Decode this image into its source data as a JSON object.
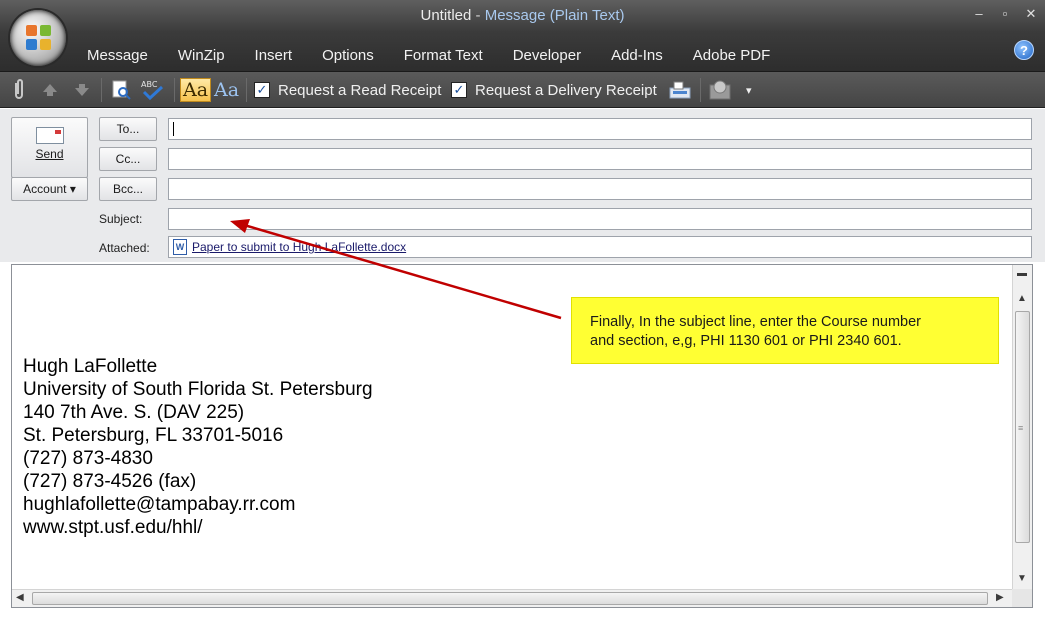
{
  "window": {
    "title_doc": "Untitled",
    "title_sep": " - ",
    "title_app": "Message (Plain Text)",
    "controls": [
      "–",
      "▫",
      "✕"
    ]
  },
  "ribbon": {
    "tabs": [
      "Message",
      "WinZip",
      "Insert",
      "Options",
      "Format Text",
      "Developer",
      "Add-Ins",
      "Adobe PDF"
    ],
    "help": "?"
  },
  "toolbar": {
    "aa_label": "Aa",
    "read_receipt_check": "✓",
    "read_receipt_label": "Request a Read Receipt",
    "delivery_receipt_check": "✓",
    "delivery_receipt_label": "Request a Delivery Receipt",
    "more": "▾"
  },
  "compose": {
    "send_label": "Send",
    "account_label": "Account ▾",
    "to_label": "To...",
    "cc_label": "Cc...",
    "bcc_label": "Bcc...",
    "subject_label": "Subject:",
    "attached_label": "Attached:",
    "to_value": "",
    "cc_value": "",
    "bcc_value": "",
    "subject_value": "",
    "attachment_name": "Paper to submit to Hugh LaFollette.docx",
    "doc_icon": "W"
  },
  "body": {
    "signature": [
      "Hugh LaFollette",
      "University of South Florida St. Petersburg",
      "140 7th Ave. S. (DAV 225)",
      "St. Petersburg, FL 33701-5016",
      "(727) 873-4830",
      "(727) 873-4526 (fax)",
      "hughlafollette@tampabay.rr.com",
      "www.stpt.usf.edu/hhl/"
    ]
  },
  "callout": {
    "line1": "Finally, In the subject line, enter the Course number",
    "line2": "and section, e,g, PHI 1130 601  or PHI 2340 601."
  },
  "colors": {
    "callout_bg": "#ffff33",
    "arrow": "#c00000",
    "title_app": "#a9c9ee"
  }
}
